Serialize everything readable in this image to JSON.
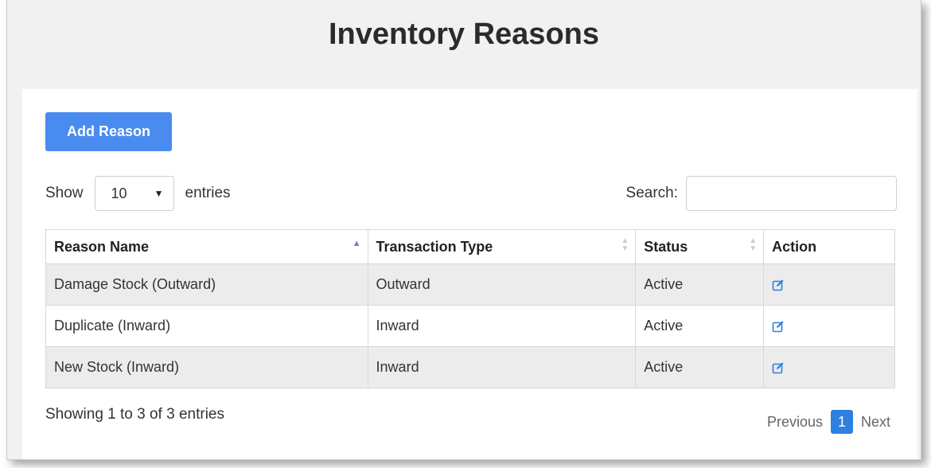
{
  "page": {
    "title": "Inventory Reasons"
  },
  "toolbar": {
    "add_label": "Add Reason"
  },
  "length_menu": {
    "show_label": "Show",
    "selected": "10",
    "entries_label": "entries"
  },
  "search": {
    "label": "Search:",
    "value": "",
    "placeholder": ""
  },
  "table": {
    "columns": [
      "Reason Name",
      "Transaction Type",
      "Status",
      "Action"
    ],
    "rows": [
      {
        "reason": "Damage Stock (Outward)",
        "type": "Outward",
        "status": "Active",
        "action_icon": "edit-icon"
      },
      {
        "reason": "Duplicate (Inward)",
        "type": "Inward",
        "status": "Active",
        "action_icon": "edit-icon"
      },
      {
        "reason": "New Stock (Inward)",
        "type": "Inward",
        "status": "Active",
        "action_icon": "edit-icon"
      }
    ]
  },
  "footer": {
    "info": "Showing 1 to 3 of 3 entries",
    "previous_label": "Previous",
    "current_page": "1",
    "next_label": "Next"
  },
  "colors": {
    "primary_button": "#4a8bf0",
    "current_page": "#2d7fe0",
    "edit_icon": "#2d7fe0",
    "striped_row": "#ececec"
  }
}
